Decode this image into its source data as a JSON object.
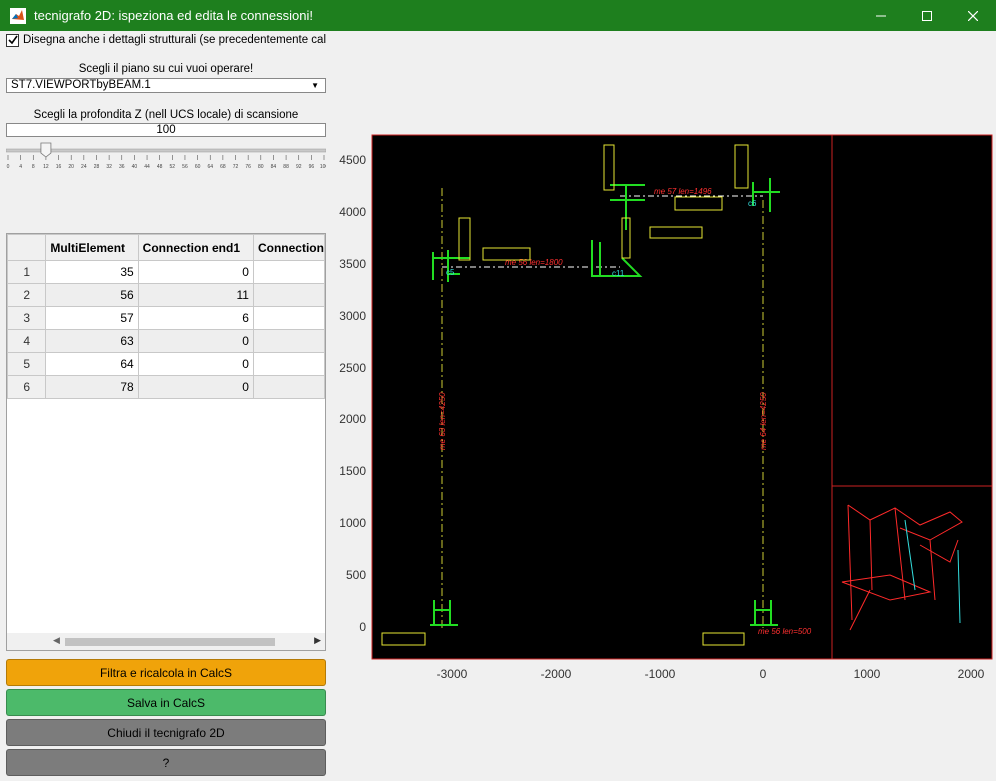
{
  "window": {
    "title": "tecnigrafo 2D: ispeziona ed edita le connessioni!"
  },
  "controls": {
    "draw_details_label": "Disegna anche i dettagli strutturali (se precedentemente calcol...",
    "draw_details_checked": true,
    "plane_label": "Scegli il piano su cui vuoi operare!",
    "plane_value": "ST7.VIEWPORTbyBEAM.1",
    "depth_label": "Scegli la profondita Z (nell UCS locale) di scansione",
    "depth_value": "100",
    "slider_ticks": [
      "0",
      "4",
      "8",
      "12",
      "16",
      "20",
      "24",
      "28",
      "32",
      "36",
      "40",
      "44",
      "48",
      "52",
      "56",
      "60",
      "64",
      "68",
      "72",
      "76",
      "80",
      "84",
      "88",
      "92",
      "96",
      "100"
    ],
    "slider_level": 12
  },
  "table": {
    "headers": [
      "MultiElement",
      "Connection end1",
      "Connection"
    ],
    "rows": [
      {
        "n": "1",
        "multi": "35",
        "end1": "0"
      },
      {
        "n": "2",
        "multi": "56",
        "end1": "11"
      },
      {
        "n": "3",
        "multi": "57",
        "end1": "6"
      },
      {
        "n": "4",
        "multi": "63",
        "end1": "0"
      },
      {
        "n": "5",
        "multi": "64",
        "end1": "0"
      },
      {
        "n": "6",
        "multi": "78",
        "end1": "0"
      }
    ]
  },
  "buttons": {
    "filter": "Filtra e ricalcola in CalcS",
    "save": "Salva in CalcS",
    "close": "Chiudi il tecnigrafo 2D",
    "help": "?"
  },
  "colors": {
    "titlebar": "#1e7f1e",
    "filter_button": "#f0a30a",
    "save_button": "#4cba6a",
    "gray_button": "#7c7c7c"
  },
  "plot": {
    "y_ticks": [
      "4500",
      "4000",
      "3500",
      "3000",
      "2500",
      "2000",
      "1500",
      "1000",
      "500",
      "0"
    ],
    "x_ticks": [
      "-3000",
      "-2000",
      "-1000",
      "0",
      "1000",
      "2000"
    ],
    "annotations": [
      "me 57 len=1496",
      "me 56 len=1800",
      "me 63 len=4250",
      "me 64 len=4250",
      "me 56 len=500",
      "c11",
      "c6",
      "c5"
    ]
  }
}
